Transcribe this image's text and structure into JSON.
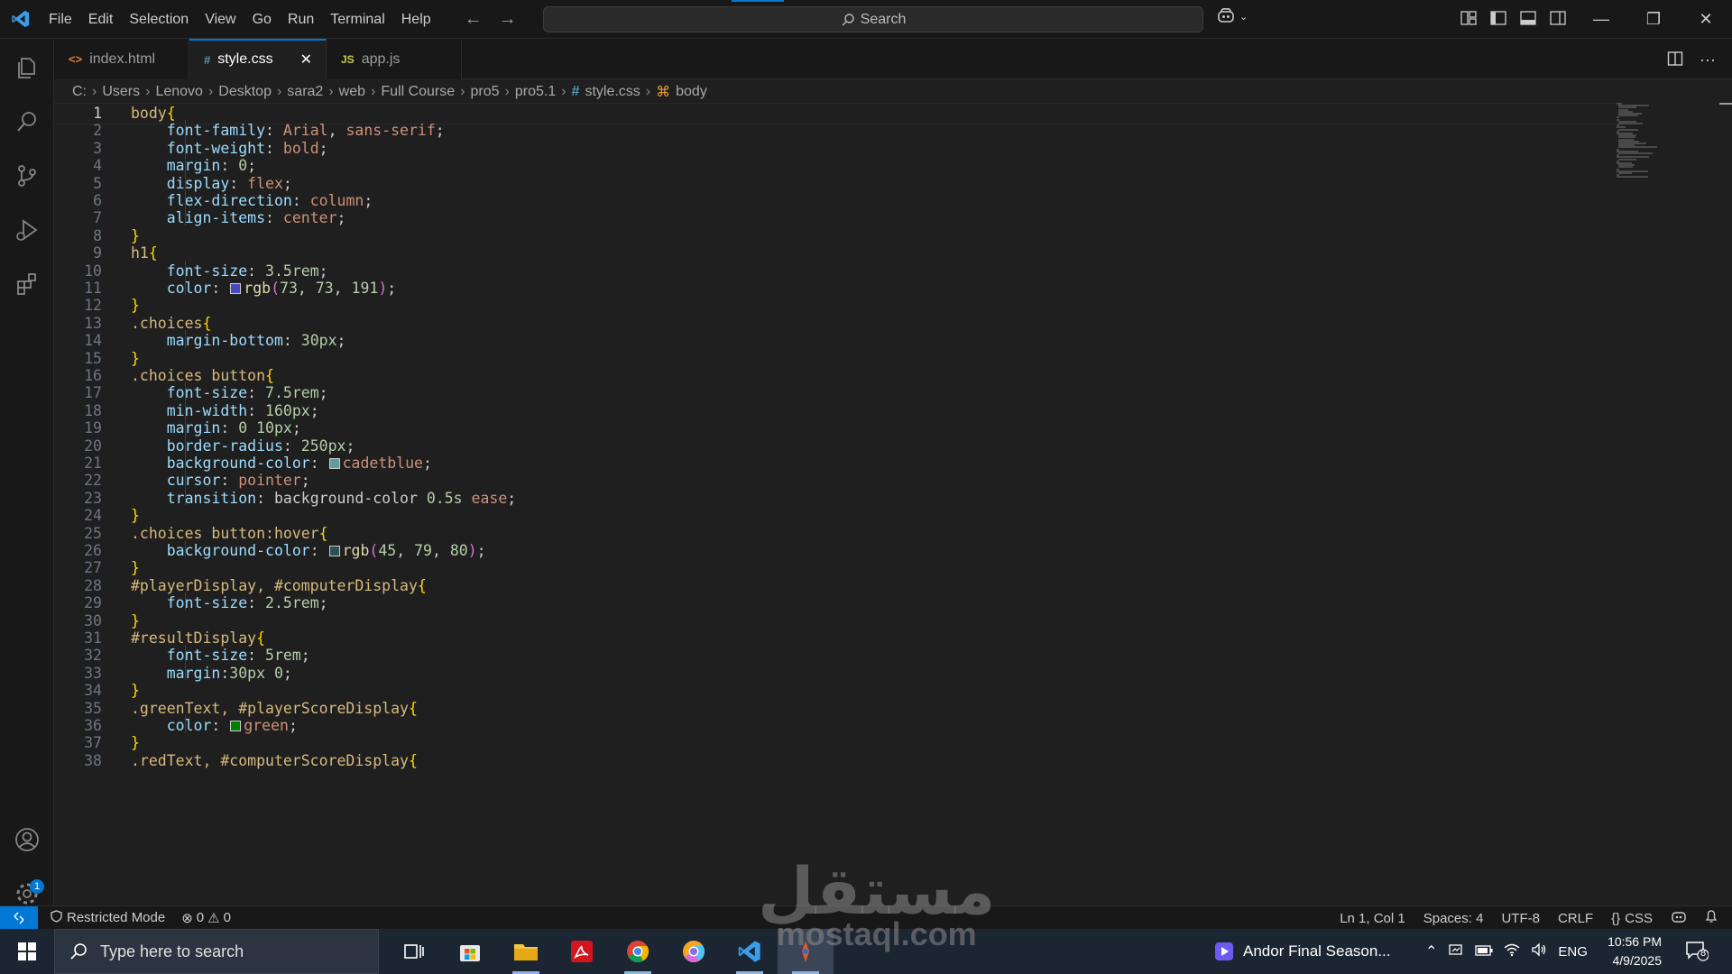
{
  "menu": [
    "File",
    "Edit",
    "Selection",
    "View",
    "Go",
    "Run",
    "Terminal",
    "Help"
  ],
  "search": {
    "label": "Search"
  },
  "tabs": [
    {
      "label": "index.html",
      "icon": "html-icon",
      "glyph": "<>",
      "color": "#e37933"
    },
    {
      "label": "style.css",
      "icon": "css-hash-icon",
      "glyph": "#",
      "color": "#519aba",
      "active": true
    },
    {
      "label": "app.js",
      "icon": "js-icon",
      "glyph": "JS",
      "color": "#cbcb41"
    }
  ],
  "breadcrumb": [
    "C:",
    "Users",
    "Lenovo",
    "Desktop",
    "sara2",
    "web",
    "Full Course",
    "pro5",
    "pro5.1",
    "style.css",
    "body"
  ],
  "code": [
    "body{",
    "    font-family: Arial, sans-serif;",
    "    font-weight: bold;",
    "    margin: 0;",
    "    display: flex;",
    "    flex-direction: column;",
    "    align-items: center;",
    "}",
    "h1{",
    "    font-size: 3.5rem;",
    "    color: rgb(73, 73, 191);",
    "}",
    ".choices{",
    "    margin-bottom: 30px;",
    "}",
    ".choices button{",
    "    font-size: 7.5rem;",
    "    min-width: 160px;",
    "    margin: 0 10px;",
    "    border-radius: 250px;",
    "    background-color: cadetblue;",
    "    cursor: pointer;",
    "    transition: background-color 0.5s ease;",
    "}",
    ".choices button:hover{",
    "    background-color: rgb(45, 79, 80);",
    "}",
    "#playerDisplay, #computerDisplay{",
    "    font-size: 2.5rem;",
    "}",
    "#resultDisplay{",
    "    font-size: 5rem;",
    "    margin:30px 0;",
    "}",
    ".greenText, #playerScoreDisplay{",
    "    color: green;",
    "}",
    ".redText, #computerScoreDisplay{"
  ],
  "swatches": {
    "11": "#4949bf",
    "21": "#5f9ea0",
    "26": "#2d4f50",
    "36": "#008000"
  },
  "status": {
    "restricted": "Restricted Mode",
    "errors": "0",
    "warnings": "0",
    "position": "Ln 1, Col 1",
    "spaces": "Spaces: 4",
    "encoding": "UTF-8",
    "eol": "CRLF",
    "language": "CSS"
  },
  "activity_badge": "1",
  "taskbar": {
    "search_placeholder": "Type here to search",
    "media": "Andor Final Season...",
    "lang": "ENG",
    "time": "10:56 PM",
    "date": "4/9/2025",
    "notifications": "8"
  },
  "watermark": {
    "arabic": "مستقل",
    "latin": "mostaql.com"
  },
  "colors": {
    "accent": "#0078d4",
    "editor_bg": "#1f1f1f",
    "chrome_bg": "#181818"
  }
}
